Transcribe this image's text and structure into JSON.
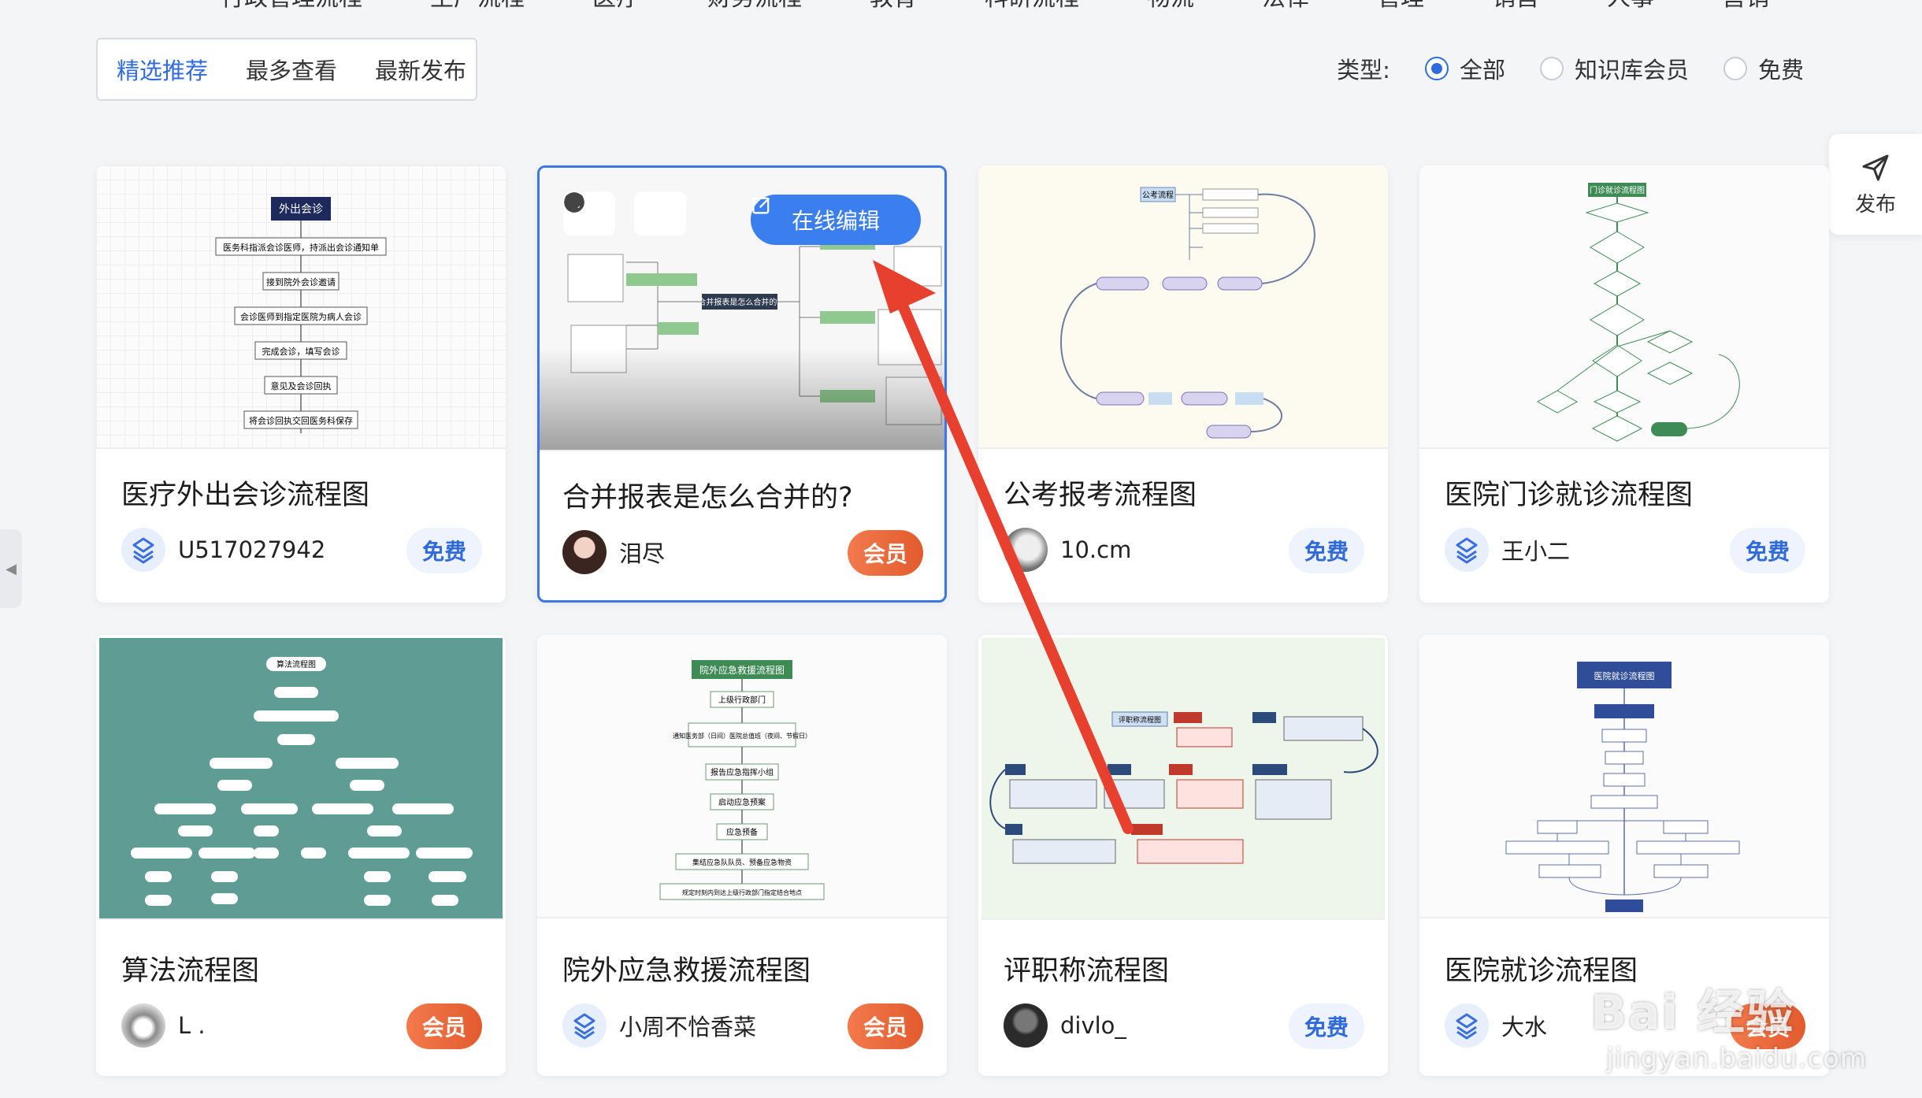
{
  "top_nav": [
    "行政管理流程",
    "生产流程",
    "医疗",
    "财务流程",
    "教育",
    "科研流程",
    "物流",
    "法律",
    "管理",
    "销售",
    "人事",
    "营销"
  ],
  "filter_tabs": [
    {
      "label": "精选推荐",
      "active": true
    },
    {
      "label": "最多查看",
      "active": false
    },
    {
      "label": "最新发布",
      "active": false
    }
  ],
  "type_filter": {
    "label": "类型:",
    "options": [
      {
        "label": "全部",
        "checked": true
      },
      {
        "label": "知识库会员",
        "checked": false
      },
      {
        "label": "免费",
        "checked": false
      }
    ]
  },
  "publish_button": {
    "label": "发布"
  },
  "edit_online_label": "在线编辑",
  "cards": [
    {
      "title": "医疗外出会诊流程图",
      "author": "U517027942",
      "badge": "免费",
      "badge_type": "free",
      "avatar": "logo",
      "thumb": {
        "top": "外出会诊",
        "steps": [
          "医务科指派会诊医师，持派出会诊通知单",
          "接到院外会诊邀请",
          "会诊医师到指定医院为病人会诊",
          "完成会诊，填写会诊",
          "意见及会诊回执",
          "将会诊回执交回医务科保存"
        ]
      }
    },
    {
      "title": "合并报表是怎么合并的?",
      "author": "泪尽",
      "badge": "会员",
      "badge_type": "vip",
      "avatar": "photo",
      "selected": true,
      "thumb": {
        "center": "合并报表是怎么合并的?"
      }
    },
    {
      "title": "公考报考流程图",
      "author": "10.cm",
      "badge": "免费",
      "badge_type": "free",
      "avatar": "photo2",
      "thumb": {
        "top": "公考流程"
      }
    },
    {
      "title": "医院门诊就诊流程图",
      "author": "王小二",
      "badge": "免费",
      "badge_type": "free",
      "avatar": "logo",
      "thumb": {
        "top": "门诊就诊流程图"
      }
    },
    {
      "title": "算法流程图",
      "author": "L .",
      "badge": "会员",
      "badge_type": "vip",
      "avatar": "dog",
      "thumb": {
        "top": "算法流程图"
      }
    },
    {
      "title": "院外应急救援流程图",
      "author": "小周不恰香菜",
      "badge": "会员",
      "badge_type": "vip",
      "avatar": "logo",
      "thumb": {
        "top": "院外应急救援流程图",
        "steps": [
          "上级行政部门",
          "通知医务部（日间）医院总值班（夜间、节假日）",
          "报告应急指挥小组",
          "启动应急预案",
          "应急预备",
          "集结应急队队员、预备应急物资",
          "规定时刻内到达上级行政部门指定结合地点"
        ]
      }
    },
    {
      "title": "评职称流程图",
      "author": "divlo_",
      "badge": "免费",
      "badge_type": "free",
      "avatar": "dark",
      "thumb": {
        "top": "评职称流程图"
      }
    },
    {
      "title": "医院就诊流程图",
      "author": "大水",
      "badge": "会员",
      "badge_type": "vip",
      "avatar": "logo",
      "thumb": {
        "top": "医院就诊流程图"
      }
    }
  ],
  "watermark": {
    "main": "Bai 经验",
    "sub": "jingyan.baidu.com"
  },
  "colors": {
    "accent": "#2f6bdc",
    "vip": "#e9643a",
    "arrow": "#e8402e"
  }
}
